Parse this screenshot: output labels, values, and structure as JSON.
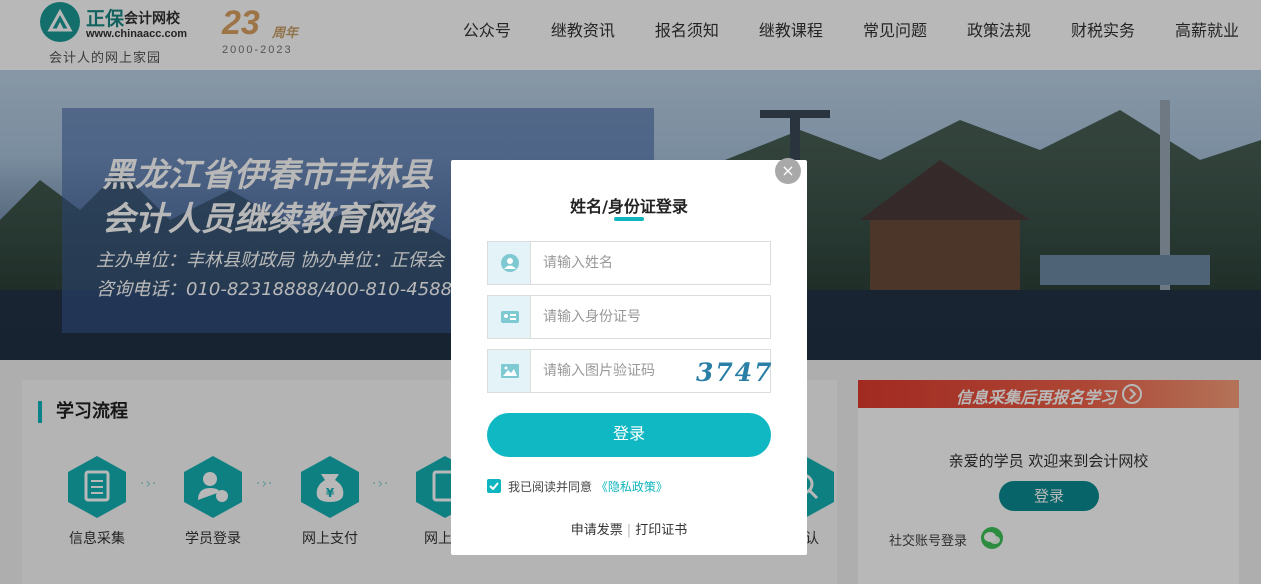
{
  "header": {
    "brand": "正保",
    "school": "会计网校",
    "url": "www.chinaacc.com",
    "slogan": "会计人的网上家园",
    "anniversary_number": "23",
    "anniversary_word": "周年",
    "anniversary_years": "2000-2023",
    "nav": [
      "公众号",
      "继教资讯",
      "报名须知",
      "继教课程",
      "常见问题",
      "政策法规",
      "财税实务",
      "高薪就业"
    ]
  },
  "banner": {
    "title_line1": "黑龙江省伊春市丰林县",
    "title_line2": "会计人员继续教育网络",
    "info_line1": "主办单位：丰林县财政局    协办单位：正保会",
    "info_line2": "咨询电话：010-82318888/400-810-4588"
  },
  "process": {
    "title": "学习流程",
    "steps": [
      "信息采集",
      "学员登录",
      "网上支付",
      "网上学",
      "确认"
    ]
  },
  "sidebar": {
    "banner_text": "信息采集后再报名学习",
    "welcome": "亲爱的学员 欢迎来到会计网校",
    "login_label": "登录",
    "social_label": "社交账号登录"
  },
  "modal": {
    "title": "姓名/身份证登录",
    "name_placeholder": "请输入姓名",
    "id_placeholder": "请输入身份证号",
    "captcha_placeholder": "请输入图片验证码",
    "captcha_code": "3747",
    "login_label": "登录",
    "agree_prefix": "我已阅读并同意",
    "agree_link": "《隐私政策》",
    "invoice_link": "申请发票",
    "certificate_link": "打印证书",
    "close_symbol": "×",
    "agree_checked": true
  },
  "colors": {
    "accent": "#0fb5be",
    "brand_green": "#1a8a86",
    "info_red": "#e13b2e"
  }
}
